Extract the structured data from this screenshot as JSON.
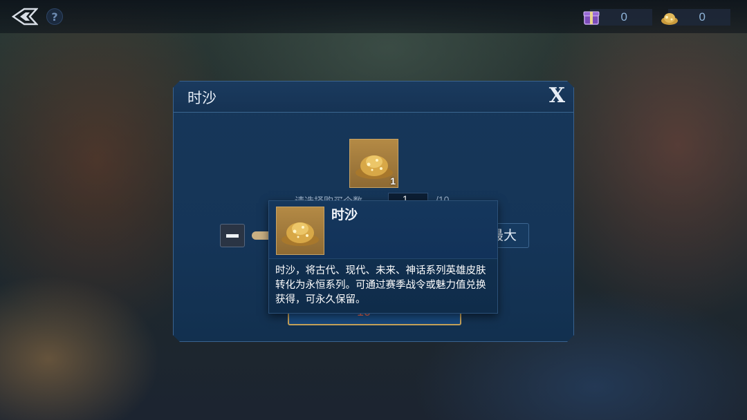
{
  "top_bar": {
    "help_label": "?",
    "currencies": [
      {
        "icon": "purple-gift-box-icon",
        "value": "0"
      },
      {
        "icon": "gold-sand-icon",
        "value": "0"
      }
    ]
  },
  "dialog": {
    "title": "时沙",
    "close_label": "X",
    "item": {
      "icon": "gold-sand-icon",
      "count": "1"
    },
    "max_label": "最大",
    "quantity": "1",
    "partial_label": "请选择购买个数",
    "partial_max": "/10",
    "price": "10"
  },
  "tooltip": {
    "title": "时沙",
    "description": "时沙，将古代、现代、未来、神话系列英雄皮肤转化为永恒系列。可通过赛季战令或魅力值兑换获得，可永久保留。"
  },
  "colors": {
    "dialog_bg": "#173759",
    "accent_gold": "#c7a35a",
    "price_red": "#e46a5a"
  }
}
